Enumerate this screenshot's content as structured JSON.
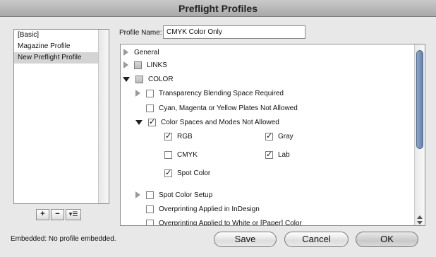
{
  "window": {
    "title": "Preflight Profiles"
  },
  "profiles": {
    "items": [
      "[Basic]",
      "Magazine Profile",
      "New Preflight Profile"
    ],
    "selected_index": 2,
    "buttons": {
      "add": "+",
      "remove": "−",
      "menu": "▾☰"
    }
  },
  "profile_name": {
    "label": "Profile Name:",
    "value": "CMYK Color Only"
  },
  "tree": {
    "general": "General",
    "links": "LINKS",
    "color": "COLOR",
    "transparency": "Transparency Blending Space Required",
    "cmy_plates": "Cyan, Magenta or Yellow Plates Not Allowed",
    "color_spaces": "Color Spaces and Modes Not Allowed",
    "rgb": "RGB",
    "gray": "Gray",
    "cmyk": "CMYK",
    "lab": "Lab",
    "spot_color": "Spot Color",
    "spot_setup": "Spot Color Setup",
    "overprinting_id": "Overprinting Applied in InDesign",
    "overprinting_white": "Overprinting Applied to White or [Paper] Color"
  },
  "status": {
    "embedded": "Embedded:  No profile embedded."
  },
  "buttons": {
    "save": "Save",
    "cancel": "Cancel",
    "ok": "OK"
  }
}
